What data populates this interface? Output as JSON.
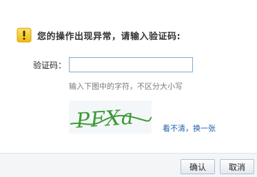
{
  "dialog": {
    "warning_message": "您的操作出现异常，请输入验证码:",
    "field_label": "验证码：",
    "input_value": "",
    "input_placeholder": "",
    "hint": "输入下图中的字符，不区分大小写",
    "captcha_text": "PFXa",
    "refresh_link": "看不清，换一张",
    "ok_label": "确认",
    "cancel_label": "取消"
  },
  "colors": {
    "warning_icon": "#f2c21b",
    "link": "#1a5fa8",
    "captcha_text": "#3f9a38",
    "input_border": "#7fa9cf"
  },
  "icons": {
    "warning": "warning-icon"
  }
}
